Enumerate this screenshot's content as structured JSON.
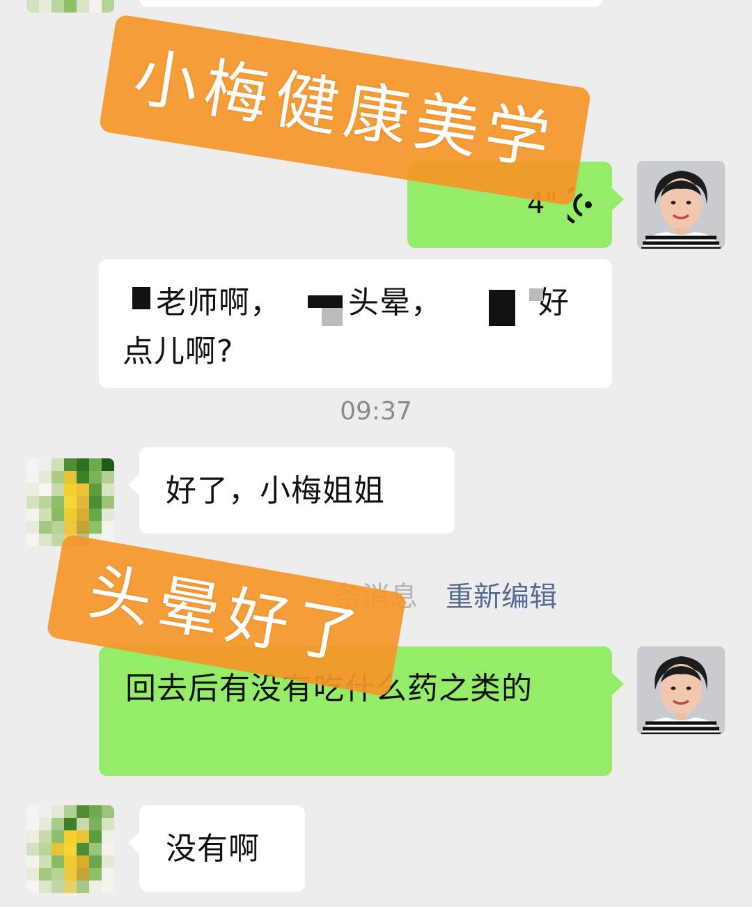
{
  "messages": [
    {
      "id": "voice",
      "side": "right",
      "type": "voice",
      "duration": "4\""
    },
    {
      "id": "m1",
      "side": "left",
      "text_line1_a": "老师啊，",
      "text_line1_b": "头晕，",
      "text_line1_c": "好",
      "text_line2": "点儿啊?"
    },
    {
      "id": "m2",
      "side": "left",
      "text": "好了，小梅姐姐"
    },
    {
      "id": "m3",
      "side": "right",
      "text": "回去后有没有吃什么药之类的"
    },
    {
      "id": "m4",
      "side": "left",
      "text": "没有啊"
    }
  ],
  "timestamp": "09:37",
  "recall_notice": {
    "text": "条消息",
    "action": "重新编辑"
  },
  "stickers": {
    "top": "小梅健康美学",
    "middle": "头晕好了"
  },
  "colors": {
    "background": "#ededed",
    "bubble_sent": "#95ec69",
    "bubble_received": "#ffffff",
    "sticker": "#f5962a",
    "link": "#576b95"
  },
  "icons": [
    "voice-wave-icon",
    "avatar-user",
    "avatar-contact"
  ]
}
